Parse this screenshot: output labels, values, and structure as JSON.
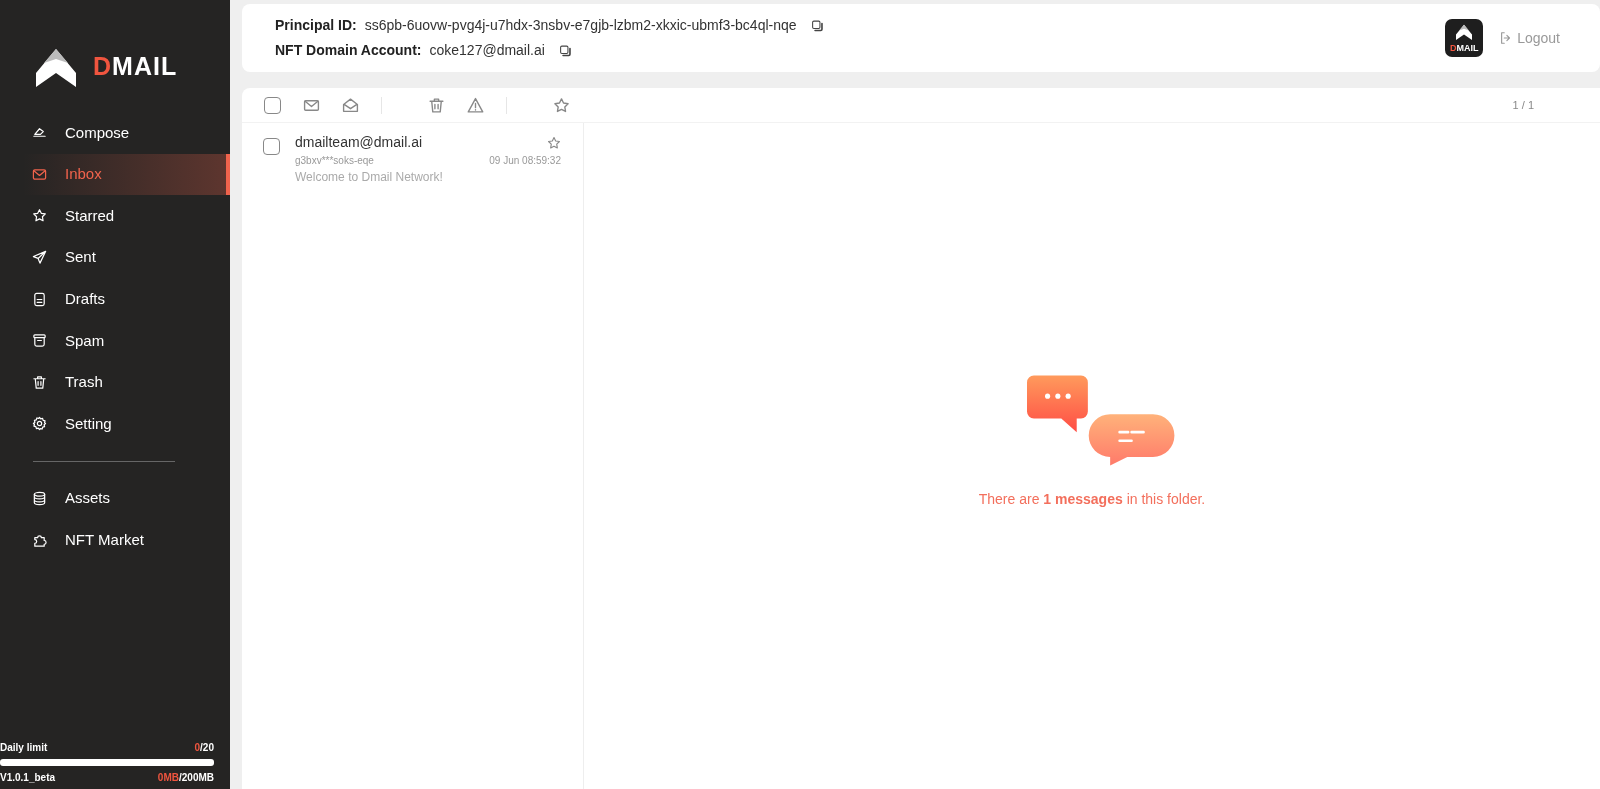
{
  "sidebar": {
    "logo": {
      "accent": "D",
      "rest": "MAIL"
    },
    "nav_items": [
      {
        "label": "Compose",
        "selected": false
      },
      {
        "label": "Inbox",
        "selected": true
      },
      {
        "label": "Starred",
        "selected": false
      },
      {
        "label": "Sent",
        "selected": false
      },
      {
        "label": "Drafts",
        "selected": false
      },
      {
        "label": "Spam",
        "selected": false
      },
      {
        "label": "Trash",
        "selected": false
      },
      {
        "label": "Setting",
        "selected": false
      }
    ],
    "extra_items": [
      {
        "label": "Assets",
        "selected": false
      },
      {
        "label": "NFT Market",
        "selected": false
      }
    ],
    "daily_limit": {
      "label": "Daily limit",
      "used": "0",
      "total": "/20",
      "level": 0
    },
    "version": "V1.0.1_beta",
    "storage": {
      "used": "0MB",
      "total": "/200MB"
    }
  },
  "header": {
    "fields": [
      {
        "label": "Principal ID:",
        "value": "ss6pb-6uovw-pvg4j-u7hdx-3nsbv-e7gjb-lzbm2-xkxic-ubmf3-bc4ql-nqe"
      },
      {
        "label": "NFT Domain Account:",
        "value": "coke127@dmail.ai"
      }
    ],
    "avatar_logo": {
      "accent": "D",
      "rest": "MAIL"
    },
    "logout": "Logout"
  },
  "toolbar": {
    "select_all": false,
    "pagination": "1 / 1"
  },
  "messages": [
    {
      "sender": "dmailteam@dmail.ai",
      "address": "g3bxv***soks-eqe",
      "time": "09 Jun 08:59:32",
      "subject": "Welcome to Dmail Network!",
      "checked": false,
      "starred": false
    }
  ],
  "empty_state": {
    "text": "There are **1 messages** in this folder."
  }
}
